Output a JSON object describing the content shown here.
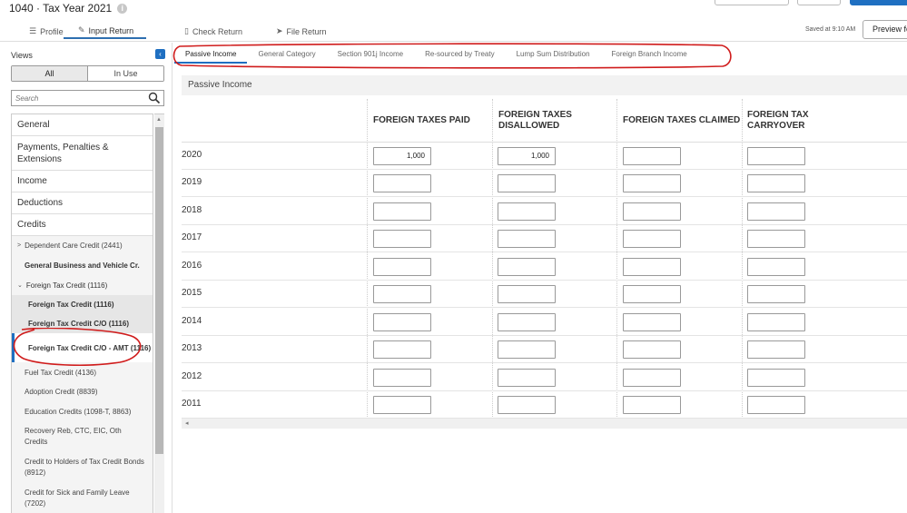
{
  "app": {
    "title": "1040 · Tax Year 2021"
  },
  "nav": {
    "tabs": [
      {
        "label": "Profile",
        "icon": "list-icon"
      },
      {
        "label": "Input Return",
        "icon": "pencil-icon"
      },
      {
        "label": "Check Return",
        "icon": "document-icon"
      },
      {
        "label": "File Return",
        "icon": "send-icon"
      }
    ],
    "saved_text": "Saved at 9:10 AM",
    "preview_label": "Preview fo"
  },
  "sidebar": {
    "views_label": "Views",
    "segments": [
      "All",
      "In Use"
    ],
    "search_placeholder": "Search",
    "items": [
      "General",
      "Payments, Penalties & Extensions",
      "Income",
      "Deductions",
      "Credits",
      "Dependent Care Credit (2441)",
      "General Business and Vehicle Cr.",
      "Foreign Tax Credit (1116)",
      "Foreign Tax Credit (1116)",
      "Foreign Tax Credit C/O (1116)",
      "Foreign Tax Credit C/O - AMT (1116)",
      "Fuel Tax Credit (4136)",
      "Adoption Credit (8839)",
      "Education Credits (1098-T, 8863)",
      "Recovery Reb, CTC, EIC, Oth Credits",
      "Credit to Holders of Tax Credit Bonds (8912)",
      "Credit for Sick and Family Leave (7202)"
    ]
  },
  "main": {
    "subtabs": [
      "Passive Income",
      "General Category",
      "Section 901j Income",
      "Re-sourced by Treaty",
      "Lump Sum Distribution",
      "Foreign Branch Income"
    ],
    "section_title": "Passive Income",
    "columns": [
      "FOREIGN TAXES PAID",
      "FOREIGN TAXES DISALLOWED",
      "FOREIGN TAXES CLAIMED",
      "FOREIGN TAX CARRYOVER"
    ],
    "rows": [
      {
        "year": "2020",
        "values": [
          "1,000",
          "1,000",
          "",
          ""
        ]
      },
      {
        "year": "2019",
        "values": [
          "",
          "",
          "",
          ""
        ]
      },
      {
        "year": "2018",
        "values": [
          "",
          "",
          "",
          ""
        ]
      },
      {
        "year": "2017",
        "values": [
          "",
          "",
          "",
          ""
        ]
      },
      {
        "year": "2016",
        "values": [
          "",
          "",
          "",
          ""
        ]
      },
      {
        "year": "2015",
        "values": [
          "",
          "",
          "",
          ""
        ]
      },
      {
        "year": "2014",
        "values": [
          "",
          "",
          "",
          ""
        ]
      },
      {
        "year": "2013",
        "values": [
          "",
          "",
          "",
          ""
        ]
      },
      {
        "year": "2012",
        "values": [
          "",
          "",
          "",
          ""
        ]
      },
      {
        "year": "2011",
        "values": [
          "",
          "",
          "",
          ""
        ]
      }
    ]
  },
  "colors": {
    "accent": "#1f6fc1",
    "annotation": "#d01c1c"
  }
}
